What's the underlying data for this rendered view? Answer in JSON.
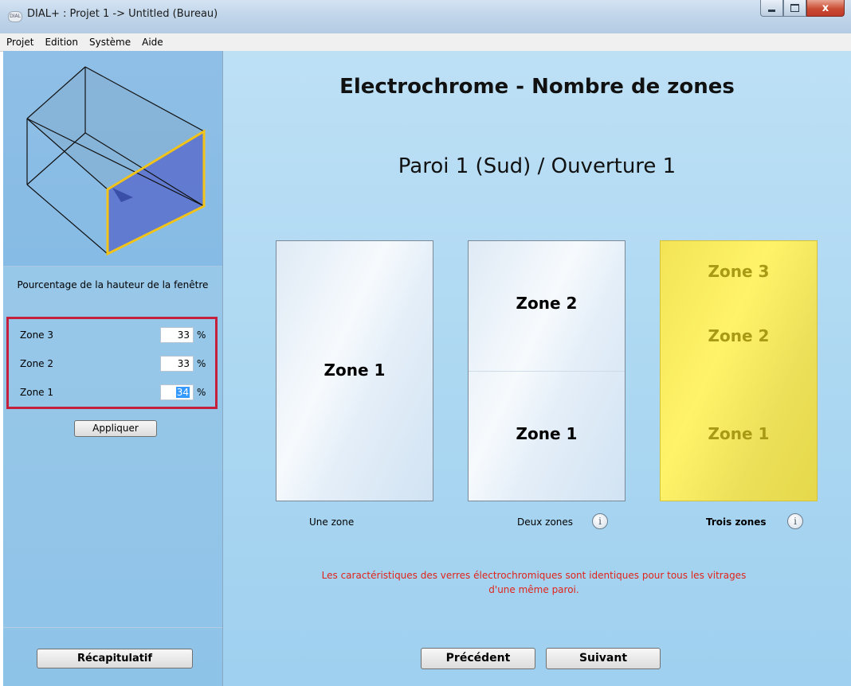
{
  "window": {
    "title": "DIAL+ : Projet 1 -> Untitled (Bureau)",
    "icon_text": "DIAL",
    "close_glyph": "x"
  },
  "menu": [
    "Projet",
    "Edition",
    "Système",
    "Aide"
  ],
  "sidebar": {
    "caption": "Pourcentage de la hauteur de la fenêtre",
    "zones": [
      {
        "label": "Zone 3",
        "value": "33",
        "unit": "%"
      },
      {
        "label": "Zone 2",
        "value": "33",
        "unit": "%"
      },
      {
        "label": "Zone 1",
        "value": "34",
        "unit": "%"
      }
    ],
    "apply_label": "Appliquer",
    "summary_label": "Récapitulatif"
  },
  "main": {
    "title": "Electrochrome - Nombre de zones",
    "subtitle": "Paroi 1 (Sud) / Ouverture 1",
    "options": [
      {
        "label": "Une zone",
        "zones": [
          "Zone 1"
        ]
      },
      {
        "label": "Deux zones",
        "zones": [
          "Zone 2",
          "Zone 1"
        ],
        "info_icon": "info-icon"
      },
      {
        "label": "Trois zones",
        "zones": [
          "Zone 3",
          "Zone 2",
          "Zone 1"
        ],
        "info_icon": "info-icon",
        "selected": true
      }
    ],
    "notice": "Les caractéristiques des verres électrochromiques sont identiques pour tous les vitrages d'une même paroi.",
    "prev_label": "Précédent",
    "next_label": "Suivant",
    "info_glyph": "i"
  },
  "colors": {
    "highlight_border": "#c4203b",
    "selected_card": "#fff36a",
    "selected_text": "#a89a14",
    "notice_text": "#e0241a",
    "window_pane": "#5a70cc",
    "frame_highlight": "#f2c319"
  }
}
